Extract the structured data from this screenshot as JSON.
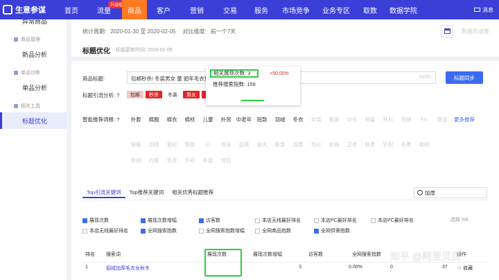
{
  "app": {
    "name": "生意参谋"
  },
  "nav": {
    "items": [
      {
        "label": "首页",
        "w": 42
      },
      {
        "label": "流量",
        "w": 52
      },
      {
        "label": "商品",
        "w": 36
      },
      {
        "label": "客户",
        "w": 48
      },
      {
        "label": "营销",
        "w": 48
      },
      {
        "label": "交易",
        "w": 48
      },
      {
        "label": "服务",
        "w": 42
      },
      {
        "label": "市场竞争",
        "w": 58
      },
      {
        "label": "业务专区",
        "w": 58
      },
      {
        "label": "取数",
        "w": 40
      },
      {
        "label": "数据学院",
        "w": 56
      }
    ],
    "upgrade_badge": "升级啦",
    "message_label": "消息"
  },
  "sidebar": {
    "top_cut": "异常商品",
    "groups": [
      {
        "group": "商品管理",
        "item": "新品分析"
      },
      {
        "group": "单品诊断",
        "item": "单品分析"
      },
      {
        "group": "相关工具",
        "item": "标题优化"
      }
    ]
  },
  "stats": {
    "period_label": "统计周期:",
    "period_value": "2020-01-30 至 2020-02-05",
    "compare_label": "对比维度:",
    "compare_value": "前一个7天",
    "link_right": "数据作战室"
  },
  "panel": {
    "title": "标题优化",
    "subtitle": "标题更新时间: 2020-02-05",
    "item_title_label": "商品标题:",
    "item_title_value": "包邮秒杀! 冬装男女 童 貂年毛衣加厚 上衣",
    "title_count": "45/60",
    "sync_button": "标题同步",
    "traffic_label": "标题引流分析:",
    "tokens": [
      {
        "text": "包邮",
        "style": "t-pink",
        "w": 24
      },
      {
        "text": "秒杀",
        "style": "t-red",
        "w": 24
      },
      {
        "text": "冬装",
        "style": "t-white",
        "w": 24
      },
      {
        "text": "男女",
        "style": "t-red",
        "w": 24
      },
      {
        "text": "童",
        "style": "t-red",
        "w": 24
      },
      {
        "text": "貂年",
        "style": "t-red",
        "w": 24
      },
      {
        "text": "加厚",
        "style": "t-mid",
        "w": 24
      },
      {
        "text": "毛衣",
        "style": "t-red",
        "w": 24
      },
      {
        "text": "上衣",
        "style": "t-white",
        "w": 24
      }
    ],
    "popup": {
      "impr_label": "相关展现次数:",
      "impr_value": "3",
      "pct": "+50.00%",
      "search_label": "推荐搜索指数:",
      "search_value": "159"
    },
    "suggest_label": "智能推荐词根:",
    "suggest_row1": [
      "外套",
      "棉服",
      "棉衣",
      "棉袄",
      "儿童",
      "外贸",
      "中老年",
      "短款",
      "羽绒",
      "冬衣"
    ],
    "suggest_row1_faded": [
      "女装",
      "批发",
      "中长",
      "短装",
      "外衫",
      "热销",
      "ins",
      "潮流"
    ],
    "more_label": "更多推荐",
    "suggest_row2_faded": [
      "保暖",
      "加绒",
      "宽松",
      "韩版",
      "小",
      "修身",
      "百搭",
      "加大",
      "新款",
      "加厚",
      "毛衫",
      "长袖",
      "卫衣",
      "秋季",
      "针织",
      "冬季",
      "棉袄",
      "休闲",
      "内搭",
      "毛衣",
      "外衫",
      "冬装",
      "情侣"
    ],
    "tabs": [
      "Top引流关键词",
      "Top推荐关键词",
      "相关优秀标题推荐"
    ],
    "search_value": "加厚",
    "checks_row1": [
      {
        "label": "展现次数",
        "on": true
      },
      {
        "label": "展现次数增幅",
        "on": true
      },
      {
        "label": "访客数",
        "on": true
      },
      {
        "label": "本店无线最好排名",
        "on": false
      },
      {
        "label": "本店PC最好排名",
        "on": false
      },
      {
        "label": "本店PC最好排名",
        "on": false
      }
    ],
    "checks_row2": [
      {
        "label": "本店无线最好排名",
        "on": false
      },
      {
        "label": "全网搜索指数",
        "on": true
      },
      {
        "label": "全网搜索指数增幅",
        "on": false
      },
      {
        "label": "全网商品指数",
        "on": false
      },
      {
        "label": "全网供需指数",
        "on": true
      }
    ],
    "select_count": "选择 5/6",
    "table": {
      "headers": [
        "排名",
        "搜索词",
        "展现次数",
        "展现次数增幅",
        "访客数",
        "全网搜索指数",
        "操作"
      ],
      "row": {
        "rank": "1",
        "keyword": "貂绒加厚毛衣女秋冬",
        "impressions": "3",
        "impr_growth": "0.00%",
        "visitors": "0",
        "search_index": "37",
        "action": "收藏"
      }
    }
  },
  "watermark": "知乎 @阿里贝贝"
}
